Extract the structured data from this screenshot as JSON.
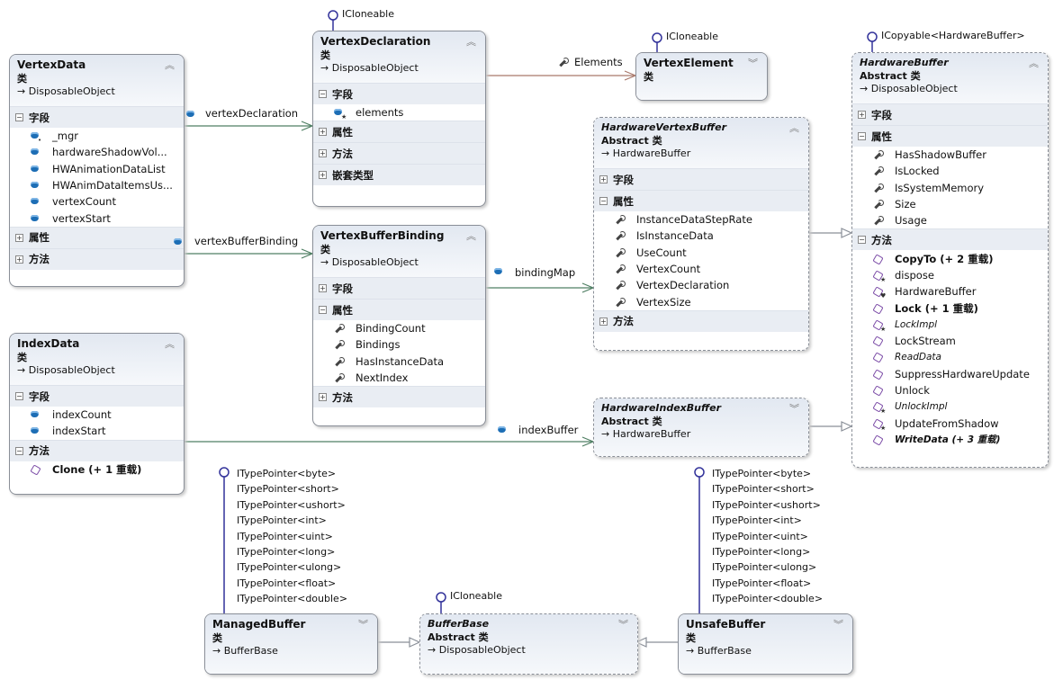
{
  "colors": {
    "association": "#4f7f63",
    "element_link": "#a9796b",
    "inheritance": "#8a8f98",
    "lollipop": "#32329a",
    "field": "#1d6eb5",
    "method": "#7d4ea8"
  },
  "classes": [
    {
      "id": "vertex-data",
      "name": "VertexData",
      "kind": "类",
      "base": "DisposableObject",
      "abstract": false,
      "toggle": "up",
      "sections": [
        {
          "label": "字段",
          "expanded": true,
          "items": [
            {
              "text": "_mgr",
              "icon": "field",
              "modifier": "private"
            },
            {
              "text": "hardwareShadowVol...",
              "icon": "field"
            },
            {
              "text": "HWAnimationDataList",
              "icon": "field"
            },
            {
              "text": "HWAnimDataItemsUs...",
              "icon": "field"
            },
            {
              "text": "vertexCount",
              "icon": "field"
            },
            {
              "text": "vertexStart",
              "icon": "field"
            }
          ]
        },
        {
          "label": "属性",
          "expanded": false,
          "items": []
        },
        {
          "label": "方法",
          "expanded": false,
          "items": []
        }
      ]
    },
    {
      "id": "vertex-declaration",
      "name": "VertexDeclaration",
      "kind": "类",
      "base": "DisposableObject",
      "abstract": false,
      "toggle": "up",
      "sections": [
        {
          "label": "字段",
          "expanded": true,
          "items": [
            {
              "text": "elements",
              "icon": "field",
              "modifier": "protected"
            }
          ]
        },
        {
          "label": "属性",
          "expanded": false,
          "items": []
        },
        {
          "label": "方法",
          "expanded": false,
          "items": []
        },
        {
          "label": "嵌套类型",
          "expanded": false,
          "items": []
        }
      ]
    },
    {
      "id": "vertex-element",
      "name": "VertexElement",
      "kind": "类",
      "base": "",
      "abstract": false,
      "toggle": "down",
      "sections": []
    },
    {
      "id": "hardware-buffer",
      "name": "HardwareBuffer",
      "kind": "Abstract 类",
      "base": "DisposableObject",
      "abstract": true,
      "toggle": "up",
      "sections": [
        {
          "label": "字段",
          "expanded": false,
          "items": []
        },
        {
          "label": "属性",
          "expanded": true,
          "items": [
            {
              "text": "HasShadowBuffer",
              "icon": "property"
            },
            {
              "text": "IsLocked",
              "icon": "property"
            },
            {
              "text": "IsSystemMemory",
              "icon": "property"
            },
            {
              "text": "Size",
              "icon": "property"
            },
            {
              "text": "Usage",
              "icon": "property"
            }
          ]
        },
        {
          "label": "方法",
          "expanded": true,
          "items": [
            {
              "text": "CopyTo (+ 2 重载)",
              "icon": "method",
              "style": "bold"
            },
            {
              "text": "dispose",
              "icon": "method",
              "modifier": "protected"
            },
            {
              "text": "HardwareBuffer",
              "icon": "method",
              "modifier": "protected-ctor"
            },
            {
              "text": "Lock (+ 1 重载)",
              "icon": "method",
              "style": "bold"
            },
            {
              "text": "LockImpl",
              "icon": "method",
              "modifier": "protected",
              "style": "italic"
            },
            {
              "text": "LockStream",
              "icon": "method"
            },
            {
              "text": "ReadData",
              "icon": "method",
              "style": "italic"
            },
            {
              "text": "SuppressHardwareUpdate",
              "icon": "method"
            },
            {
              "text": "Unlock",
              "icon": "method"
            },
            {
              "text": "UnlockImpl",
              "icon": "method",
              "modifier": "protected",
              "style": "italic"
            },
            {
              "text": "UpdateFromShadow",
              "icon": "method",
              "modifier": "protected"
            },
            {
              "text": "WriteData (+ 3 重载)",
              "icon": "method",
              "style": "bolditalic"
            }
          ]
        }
      ]
    },
    {
      "id": "hardware-vertex-buffer",
      "name": "HardwareVertexBuffer",
      "kind": "Abstract 类",
      "base": "HardwareBuffer",
      "abstract": true,
      "toggle": "up",
      "sections": [
        {
          "label": "字段",
          "expanded": false,
          "items": []
        },
        {
          "label": "属性",
          "expanded": true,
          "items": [
            {
              "text": "InstanceDataStepRate",
              "icon": "property"
            },
            {
              "text": "IsInstanceData",
              "icon": "property"
            },
            {
              "text": "UseCount",
              "icon": "property"
            },
            {
              "text": "VertexCount",
              "icon": "property"
            },
            {
              "text": "VertexDeclaration",
              "icon": "property"
            },
            {
              "text": "VertexSize",
              "icon": "property"
            }
          ]
        },
        {
          "label": "方法",
          "expanded": false,
          "items": []
        }
      ]
    },
    {
      "id": "vertex-buffer-binding",
      "name": "VertexBufferBinding",
      "kind": "类",
      "base": "DisposableObject",
      "abstract": false,
      "toggle": "up",
      "sections": [
        {
          "label": "字段",
          "expanded": false,
          "items": []
        },
        {
          "label": "属性",
          "expanded": true,
          "items": [
            {
              "text": "BindingCount",
              "icon": "property"
            },
            {
              "text": "Bindings",
              "icon": "property"
            },
            {
              "text": "HasInstanceData",
              "icon": "property"
            },
            {
              "text": "NextIndex",
              "icon": "property"
            }
          ]
        },
        {
          "label": "方法",
          "expanded": false,
          "items": []
        }
      ]
    },
    {
      "id": "index-data",
      "name": "IndexData",
      "kind": "类",
      "base": "DisposableObject",
      "abstract": false,
      "toggle": "up",
      "sections": [
        {
          "label": "字段",
          "expanded": true,
          "items": [
            {
              "text": "indexCount",
              "icon": "field"
            },
            {
              "text": "indexStart",
              "icon": "field"
            }
          ]
        },
        {
          "label": "方法",
          "expanded": true,
          "items": [
            {
              "text": "Clone (+ 1 重载)",
              "icon": "method",
              "style": "bold"
            }
          ]
        }
      ]
    },
    {
      "id": "hardware-index-buffer",
      "name": "HardwareIndexBuffer",
      "kind": "Abstract 类",
      "base": "HardwareBuffer",
      "abstract": true,
      "toggle": "down",
      "sections": []
    },
    {
      "id": "managed-buffer",
      "name": "ManagedBuffer",
      "kind": "类",
      "base": "BufferBase",
      "abstract": false,
      "toggle": "down",
      "sections": []
    },
    {
      "id": "buffer-base",
      "name": "BufferBase",
      "kind": "Abstract 类",
      "base": "DisposableObject",
      "abstract": true,
      "toggle": "down",
      "sections": []
    },
    {
      "id": "unsafe-buffer",
      "name": "UnsafeBuffer",
      "kind": "类",
      "base": "BufferBase",
      "abstract": false,
      "toggle": "down",
      "sections": []
    }
  ],
  "interfaces": [
    {
      "class": "vertex-declaration",
      "label": "ICloneable"
    },
    {
      "class": "vertex-element",
      "label": "ICloneable"
    },
    {
      "class": "hardware-buffer",
      "label": "ICopyable<HardwareBuffer>"
    },
    {
      "class": "buffer-base",
      "label": "ICloneable"
    }
  ],
  "type_pointer_interfaces": {
    "managed_buffer": [
      "ITypePointer<byte>",
      "ITypePointer<short>",
      "ITypePointer<ushort>",
      "ITypePointer<int>",
      "ITypePointer<uint>",
      "ITypePointer<long>",
      "ITypePointer<ulong>",
      "ITypePointer<float>",
      "ITypePointer<double>"
    ],
    "unsafe_buffer": [
      "ITypePointer<byte>",
      "ITypePointer<short>",
      "ITypePointer<ushort>",
      "ITypePointer<int>",
      "ITypePointer<uint>",
      "ITypePointer<long>",
      "ITypePointer<ulong>",
      "ITypePointer<float>",
      "ITypePointer<double>"
    ]
  },
  "associations": [
    {
      "from": "vertex-data",
      "to": "vertex-declaration",
      "label": "vertexDeclaration",
      "icon": "field"
    },
    {
      "from": "vertex-data",
      "to": "vertex-buffer-binding",
      "label": "vertexBufferBinding",
      "icon": "field"
    },
    {
      "from": "vertex-declaration",
      "to": "vertex-element",
      "label": "Elements",
      "icon": "property"
    },
    {
      "from": "vertex-buffer-binding",
      "to": "hardware-vertex-buffer",
      "label": "bindingMap",
      "icon": "field"
    },
    {
      "from": "index-data",
      "to": "hardware-index-buffer",
      "label": "indexBuffer",
      "icon": "field"
    }
  ],
  "inheritance": [
    {
      "from": "hardware-vertex-buffer",
      "to": "hardware-buffer"
    },
    {
      "from": "hardware-index-buffer",
      "to": "hardware-buffer"
    },
    {
      "from": "managed-buffer",
      "to": "buffer-base"
    },
    {
      "from": "unsafe-buffer",
      "to": "buffer-base"
    }
  ]
}
